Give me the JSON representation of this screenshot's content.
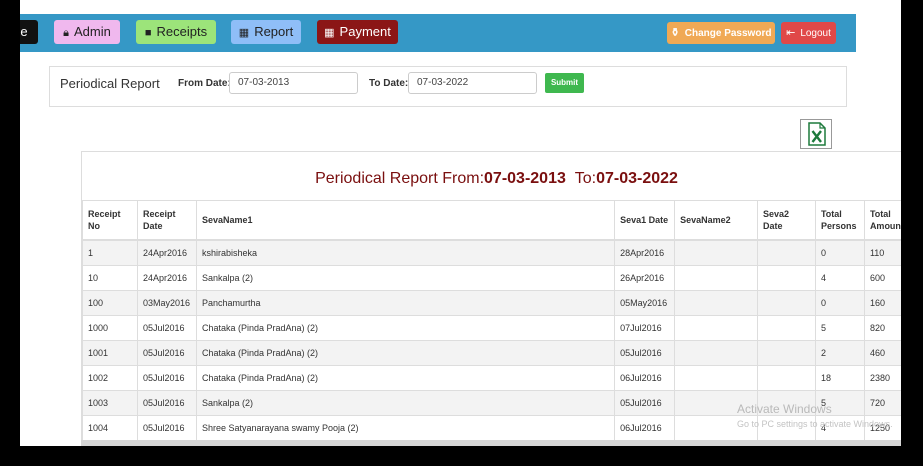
{
  "nav": {
    "home": "e",
    "admin": "Admin",
    "receipts": "Receipts",
    "report": "Report",
    "payment": "Payment",
    "change_password": "Change Password",
    "logout": "Logout"
  },
  "filter": {
    "title": "Periodical Report",
    "from_label": "From Date:",
    "from_value": "07-03-2013",
    "to_label": "To Date:",
    "to_value": "07-03-2022",
    "submit": "Submit"
  },
  "report": {
    "title_prefix": "Periodical Report From:",
    "from": "07-03-2013",
    "to_prefix": "To:",
    "to": "07-03-2022",
    "columns": [
      "Receipt No",
      "Receipt Date",
      "SevaName1",
      "Seva1 Date",
      "SevaName2",
      "Seva2 Date",
      "Total Persons",
      "Total Amount"
    ],
    "rows": [
      [
        "1",
        "24Apr2016",
        "kshirabisheka",
        "28Apr2016",
        "",
        "",
        "0",
        "110"
      ],
      [
        "10",
        "24Apr2016",
        "Sankalpa (2)",
        "26Apr2016",
        "",
        "",
        "4",
        "600"
      ],
      [
        "100",
        "03May2016",
        "Panchamurtha",
        "05May2016",
        "",
        "",
        "0",
        "160"
      ],
      [
        "1000",
        "05Jul2016",
        "Chataka (Pinda PradAna) (2)",
        "07Jul2016",
        "",
        "",
        "5",
        "820"
      ],
      [
        "1001",
        "05Jul2016",
        "Chataka (Pinda PradAna) (2)",
        "05Jul2016",
        "",
        "",
        "2",
        "460"
      ],
      [
        "1002",
        "05Jul2016",
        "Chataka (Pinda PradAna) (2)",
        "06Jul2016",
        "",
        "",
        "18",
        "2380"
      ],
      [
        "1003",
        "05Jul2016",
        "Sankalpa (2)",
        "05Jul2016",
        "",
        "",
        "5",
        "720"
      ],
      [
        "1004",
        "05Jul2016",
        "Shree Satyanarayana swamy Pooja (2)",
        "06Jul2016",
        "",
        "",
        "4",
        "1250"
      ]
    ]
  },
  "watermark": {
    "line1": "Activate Windows",
    "line2": "Go to PC settings to activate Windows."
  },
  "colors": {
    "navbar": "#3598c6",
    "title": "#7a0f0f",
    "submit": "#3fb84f"
  }
}
